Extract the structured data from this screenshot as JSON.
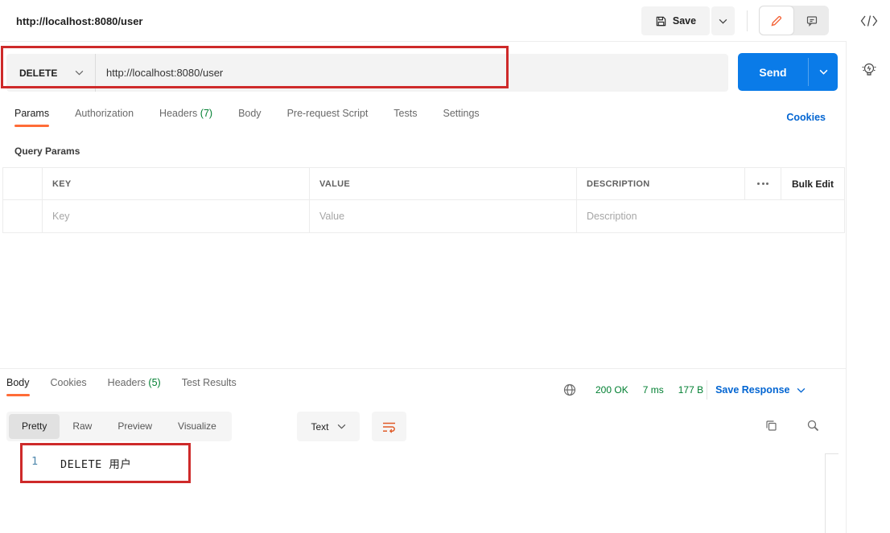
{
  "header": {
    "title": "http://localhost:8080/user",
    "save_label": "Save"
  },
  "request": {
    "method": "DELETE",
    "url": "http://localhost:8080/user",
    "send_label": "Send",
    "tabs": [
      {
        "label": "Params"
      },
      {
        "label": "Authorization"
      },
      {
        "label": "Headers",
        "count": "(7)"
      },
      {
        "label": "Body"
      },
      {
        "label": "Pre-request Script"
      },
      {
        "label": "Tests"
      },
      {
        "label": "Settings"
      }
    ],
    "cookies_link": "Cookies",
    "query_params": {
      "section_title": "Query Params",
      "columns": {
        "key": "KEY",
        "value": "VALUE",
        "description": "DESCRIPTION"
      },
      "bulk_edit_label": "Bulk Edit",
      "placeholders": {
        "key": "Key",
        "value": "Value",
        "description": "Description"
      }
    }
  },
  "response": {
    "tabs": [
      {
        "label": "Body"
      },
      {
        "label": "Cookies"
      },
      {
        "label": "Headers",
        "count": "(5)"
      },
      {
        "label": "Test Results"
      }
    ],
    "status": {
      "code": "200 OK",
      "time": "7 ms",
      "size": "177 B"
    },
    "save_response_label": "Save Response",
    "view_tabs": {
      "pretty": "Pretty",
      "raw": "Raw",
      "preview": "Preview",
      "visualize": "Visualize"
    },
    "format_select": "Text",
    "body": {
      "line_number": "1",
      "line_text": "DELETE 用户"
    }
  },
  "colors": {
    "accent_orange": "#ff6c37",
    "send_blue": "#0a7be8",
    "link_blue": "#0265d2",
    "success_green": "#007f31",
    "annotation_red": "#ce2a2a"
  }
}
